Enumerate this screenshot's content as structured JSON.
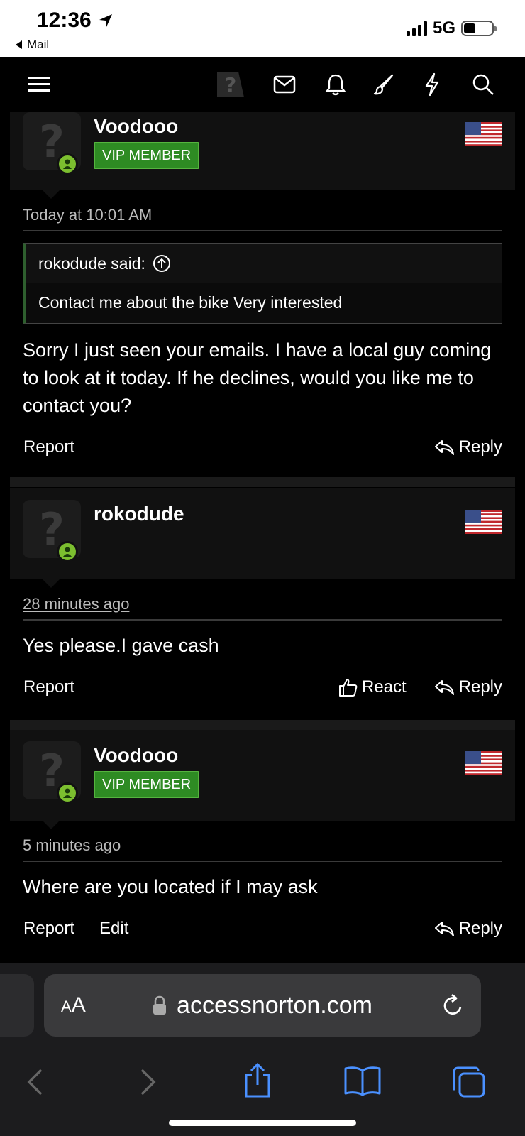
{
  "status_bar": {
    "time": "12:36",
    "back_label": "Mail",
    "network": "5G",
    "location_icon": "location-arrow-icon",
    "signal_icon": "signal-bars-icon",
    "battery_icon": "battery-icon"
  },
  "nav": {
    "icons": [
      "menu-icon",
      "site-logo-icon",
      "mail-icon",
      "bell-icon",
      "brush-icon",
      "bolt-icon",
      "search-icon"
    ]
  },
  "posts": [
    {
      "username": "Voodooo",
      "badge": "VIP MEMBER",
      "timestamp": "Today at 10:01 AM",
      "quote": {
        "author_line": "rokodude said:",
        "text": "Contact me about the bike Very interested"
      },
      "message": "Sorry I just seen your emails. I have a local guy coming to look at it today. If he declines, would you like me to contact you?",
      "actions": {
        "report": "Report",
        "reply": "Reply"
      }
    },
    {
      "username": "rokodude",
      "timestamp": "28 minutes ago",
      "message": "Yes please.I gave cash",
      "actions": {
        "report": "Report",
        "react": "React",
        "reply": "Reply"
      }
    },
    {
      "username": "Voodooo",
      "badge": "VIP MEMBER",
      "timestamp": "5 minutes ago",
      "message": "Where are you located if I may ask",
      "actions": {
        "report": "Report",
        "edit": "Edit",
        "reply": "Reply"
      }
    }
  ],
  "safari": {
    "text_size_label_small": "A",
    "text_size_label_large": "A",
    "url": "accessnorton.com",
    "toolbar_icons": [
      "back-icon",
      "forward-icon",
      "share-icon",
      "bookmarks-icon",
      "tabs-icon"
    ]
  },
  "colors": {
    "background": "#000000",
    "vip_badge": "#2e8b23",
    "online_dot": "#7cbf2f",
    "safari_bar": "#1c1c1e",
    "toolbar_blue": "#4a90ff"
  }
}
